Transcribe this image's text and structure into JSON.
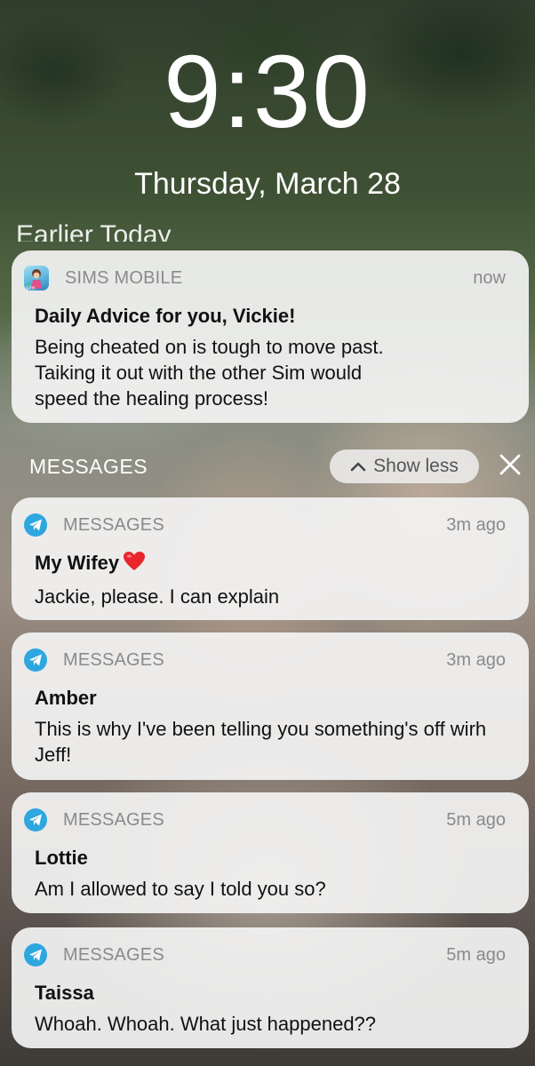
{
  "lockscreen": {
    "time": "9:30",
    "date": "Thursday, March 28",
    "section_label": "Earlier Today"
  },
  "sims_notification": {
    "app_name": "SIMS MOBILE",
    "time": "now",
    "title": "Daily Advice for you, Vickie!",
    "body": "Being cheated on is tough to move past. Taiking it out with the other Sim would speed the healing process!"
  },
  "messages_group": {
    "title": "MESSAGES",
    "show_less_label": "Show less",
    "notifications": [
      {
        "app_name": "MESSAGES",
        "time": "3m ago",
        "sender": "My Wifey",
        "body": "Jackie, please. I can explain"
      },
      {
        "app_name": "MESSAGES",
        "time": "3m ago",
        "sender": "Amber",
        "body": "This is why I've been telling you something's off wirh Jeff!"
      },
      {
        "app_name": "MESSAGES",
        "time": "5m ago",
        "sender": "Lottie",
        "body": "Am I allowed to say I told you so?"
      },
      {
        "app_name": "MESSAGES",
        "time": "5m ago",
        "sender": "Taissa",
        "body": "Whoah. Whoah. What just happened??"
      }
    ]
  },
  "colors": {
    "card_bg": "#f3f3f3",
    "secondary_text": "#8a8a8a",
    "messages_icon": "#2ea6df",
    "heart": "#e8262c"
  },
  "icons": {
    "sims_app": "sims-mobile-app-icon",
    "messages_app": "paper-plane-icon",
    "show_less": "chevron-up-icon",
    "close": "close-icon",
    "heart": "red-heart-emoji"
  }
}
